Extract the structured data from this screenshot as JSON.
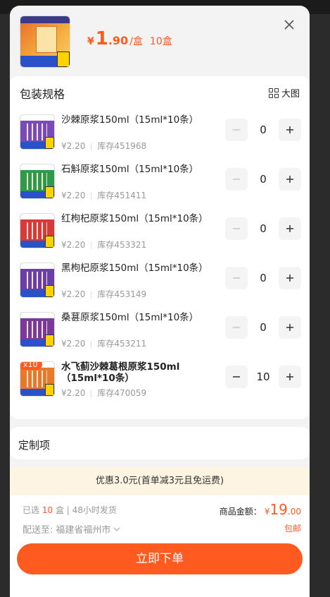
{
  "header": {
    "currency": "¥",
    "price_int": "1",
    "price_dec": ".90",
    "unit": "/盒",
    "qty": "10盒"
  },
  "spec": {
    "title": "包装规格",
    "big_view_label": "大图"
  },
  "items": [
    {
      "name": "沙棘原浆150ml（15ml*10条）",
      "price": "¥2.20",
      "stock": "库存451968",
      "count": "0",
      "theme": "#7a4bb8",
      "bold": false
    },
    {
      "name": "石斛原浆150ml（15ml*10条）",
      "price": "¥2.20",
      "stock": "库存451411",
      "count": "0",
      "theme": "#2f9a4a",
      "bold": false
    },
    {
      "name": "红枸杞原浆150ml（15ml*10条）",
      "price": "¥2.20",
      "stock": "库存453321",
      "count": "0",
      "theme": "#d83a3a",
      "bold": false
    },
    {
      "name": "黑枸杞原浆150ml（15ml*10条）",
      "price": "¥2.20",
      "stock": "库存453149",
      "count": "0",
      "theme": "#6b3fa8",
      "bold": false
    },
    {
      "name": "桑葚原浆150ml（15ml*10条）",
      "price": "¥2.20",
      "stock": "库存453211",
      "count": "0",
      "theme": "#7a3a9a",
      "bold": false
    },
    {
      "name": "水飞蓟沙棘葛根原浆150ml（15ml*10条）",
      "price": "¥2.20",
      "stock": "库存470059",
      "count": "10",
      "theme": "#e8782a",
      "bold": true,
      "badge": "x10"
    }
  ],
  "custom": {
    "label": "定制项"
  },
  "promo": {
    "text": "优惠3.0元(首单减3元且免运费)"
  },
  "footer": {
    "selected_prefix": "已选",
    "selected_count": "10",
    "selected_suffix": "盒 | 48小时发货",
    "amount_label": "商品金额：",
    "amount_currency": "¥",
    "amount_int": "19",
    "amount_dec": ".00",
    "ship_label": "配送至:",
    "ship_addr": "福建省福州市",
    "free_shipping": "包邮",
    "order_button": "立即下单"
  },
  "colors": {
    "accent": "#ff5a1f",
    "promo_bg": "#fdf5e2"
  }
}
